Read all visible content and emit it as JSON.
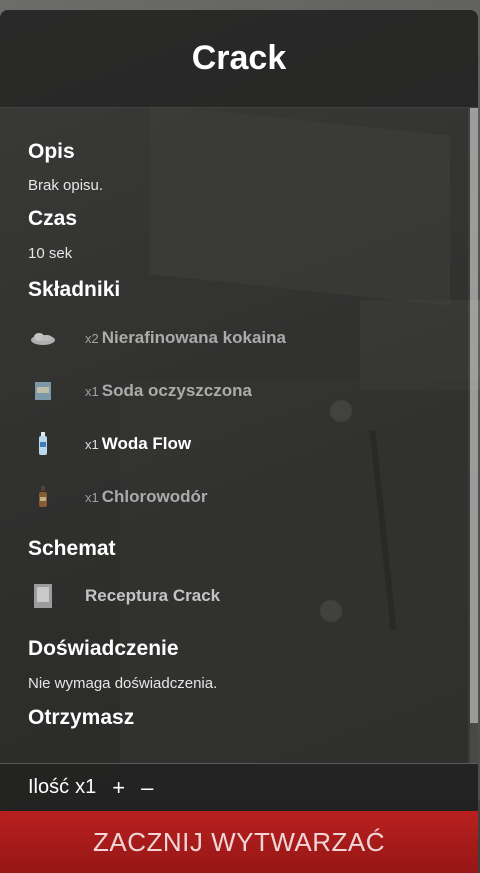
{
  "title": "Crack",
  "sections": {
    "description": {
      "label": "Opis",
      "text": "Brak opisu."
    },
    "time": {
      "label": "Czas",
      "text": "10 sek"
    },
    "ingredients": {
      "label": "Składniki",
      "items": [
        {
          "qty": "x2",
          "name": "Nierafinowana kokaina",
          "icon": "cocaine-icon"
        },
        {
          "qty": "x1",
          "name": "Soda oczyszczona",
          "icon": "soda-box-icon"
        },
        {
          "qty": "x1",
          "name": "Woda Flow",
          "icon": "water-bottle-icon"
        },
        {
          "qty": "x1",
          "name": "Chlorowodór",
          "icon": "acid-bottle-icon"
        }
      ]
    },
    "schematic": {
      "label": "Schemat",
      "name": "Receptura Crack",
      "icon": "recipe-paper-icon"
    },
    "experience": {
      "label": "Doświadczenie",
      "text": "Nie wymaga doświadczenia."
    },
    "receive": {
      "label": "Otrzymasz"
    }
  },
  "footer": {
    "amount_label": "Ilość",
    "amount_value": "x1",
    "plus": "+",
    "minus": "–"
  },
  "start_button": "ZACZNIJ WYTWARZAĆ",
  "colors": {
    "button": "#a81c1b",
    "panel": "#1e1e1e"
  }
}
